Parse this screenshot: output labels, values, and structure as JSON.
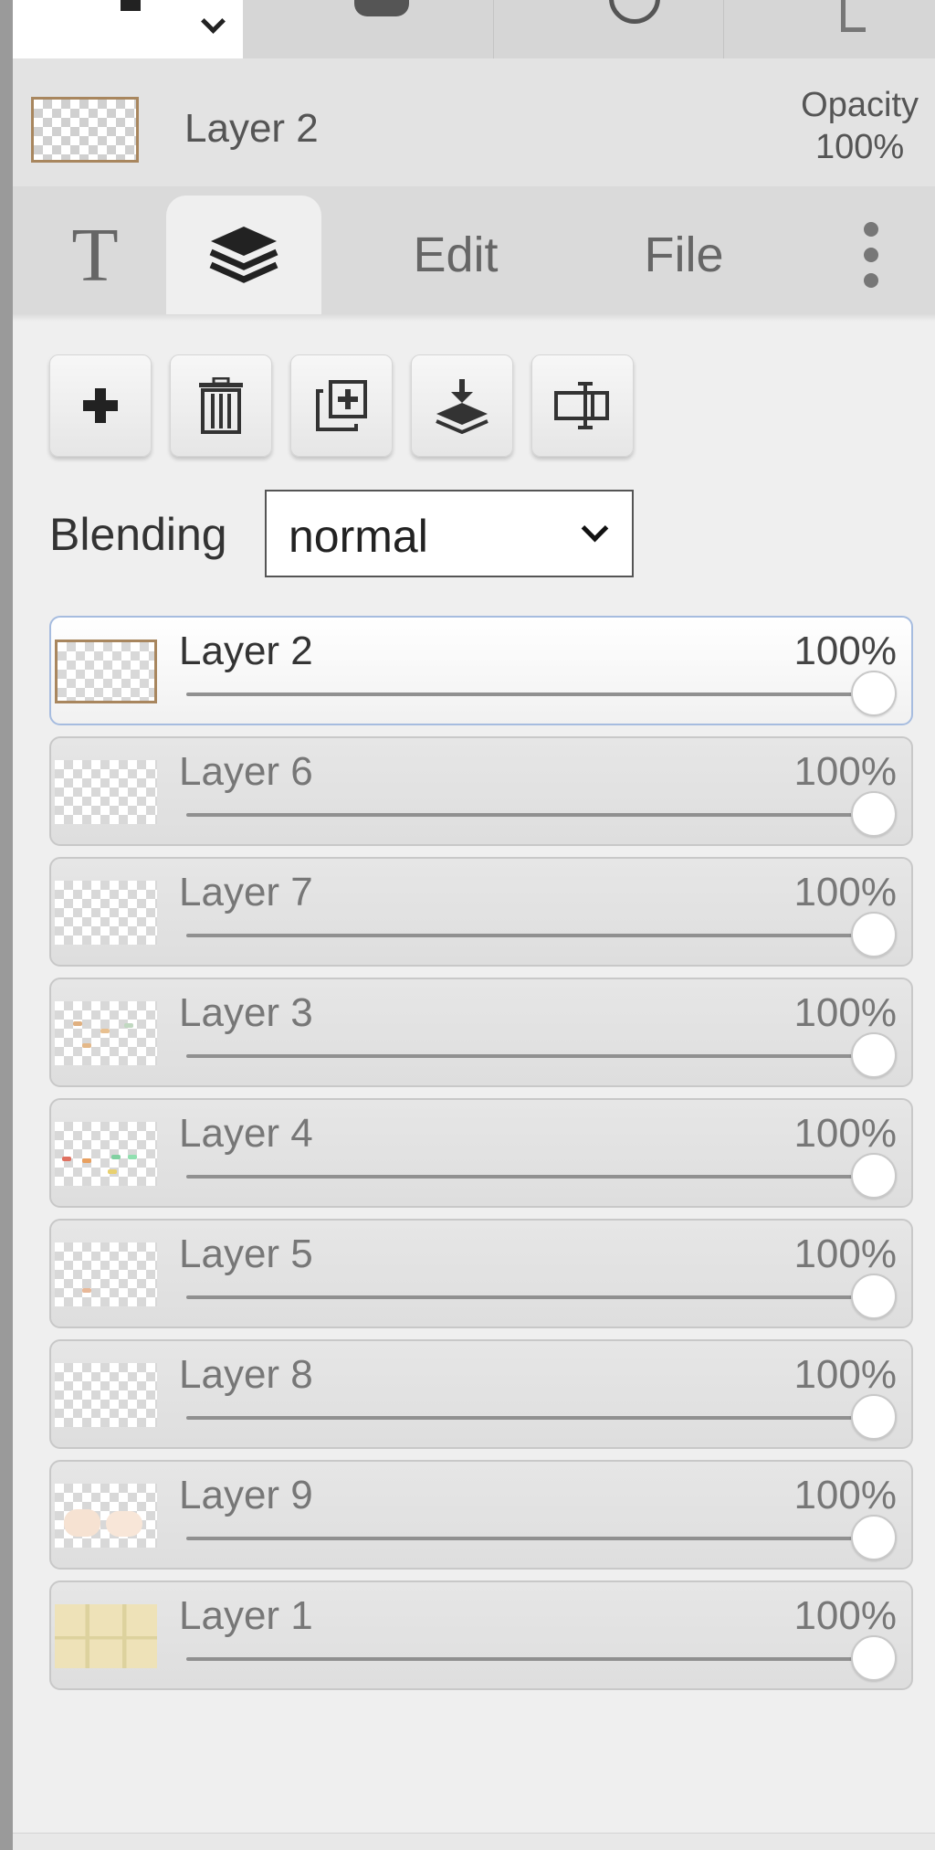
{
  "header": {
    "layer_name": "Layer 2",
    "opacity_label": "Opacity",
    "opacity_value": "100%"
  },
  "tabs": [
    {
      "label": "T",
      "icon": "text-tool-icon"
    },
    {
      "label": "",
      "icon": "layers-icon",
      "active": true
    },
    {
      "label": "Edit"
    },
    {
      "label": "File"
    },
    {
      "label": "",
      "icon": "more-vertical-icon"
    }
  ],
  "toolbar": {
    "buttons": [
      "add-layer-icon",
      "delete-layer-icon",
      "duplicate-layer-icon",
      "merge-down-icon",
      "rename-layer-icon"
    ]
  },
  "blending": {
    "label": "Blending",
    "value": "normal"
  },
  "layers": [
    {
      "name": "Layer 2",
      "opacity": "100%",
      "selected": true
    },
    {
      "name": "Layer 6",
      "opacity": "100%"
    },
    {
      "name": "Layer 7",
      "opacity": "100%"
    },
    {
      "name": "Layer 3",
      "opacity": "100%"
    },
    {
      "name": "Layer 4",
      "opacity": "100%"
    },
    {
      "name": "Layer 5",
      "opacity": "100%"
    },
    {
      "name": "Layer 8",
      "opacity": "100%"
    },
    {
      "name": "Layer 9",
      "opacity": "100%"
    },
    {
      "name": "Layer 1",
      "opacity": "100%"
    }
  ],
  "colors": {
    "selected_border": "#a6bcdf",
    "thumb_frame": "#a8865e"
  }
}
